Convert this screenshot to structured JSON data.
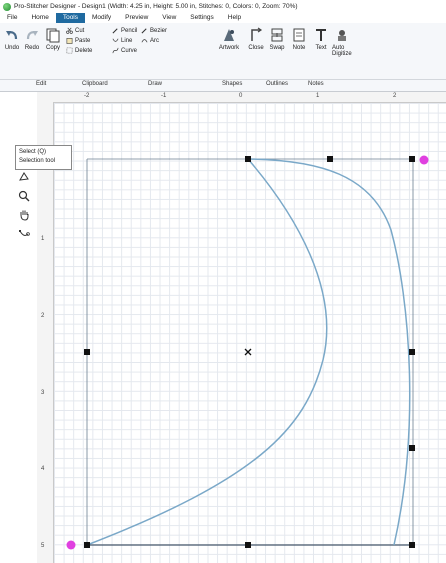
{
  "window": {
    "title": "Pro-Stitcher Designer - Design1 (Width: 4.25 in, Height: 5.00 in, Stitches: 0, Colors: 0, Zoom: 70%)"
  },
  "menu": {
    "items": [
      {
        "label": "File"
      },
      {
        "label": "Home"
      },
      {
        "label": "Tools",
        "active": true
      },
      {
        "label": "Modify"
      },
      {
        "label": "Preview"
      },
      {
        "label": "View"
      },
      {
        "label": "Settings"
      },
      {
        "label": "Help"
      }
    ]
  },
  "ribbon": {
    "undo": "Undo",
    "redo": "Redo",
    "copy": "Copy",
    "cut": "Cut",
    "paste": "Paste",
    "delete": "Delete",
    "pencil": "Pencil",
    "bezier": "Bezier",
    "line": "Line",
    "arc": "Arc",
    "curve": "Curve",
    "artwork": "Artwork",
    "close": "Close",
    "swap": "Swap",
    "note": "Note",
    "text": "Text",
    "auto_line1": "Auto",
    "auto_line2": "Digitize",
    "groups": {
      "edit": "Edit",
      "clipboard": "Clipboard",
      "draw": "Draw",
      "shapes": "Shapes",
      "outlines": "Outlines",
      "notes": "Notes"
    }
  },
  "tooltip": {
    "line1": "Select (Q)",
    "line2": "Selection tool"
  },
  "ruler": {
    "top_labels": [
      "-2",
      "-1",
      "0",
      "1",
      "2"
    ],
    "left_labels": [
      "1",
      "2",
      "3",
      "4",
      "5"
    ]
  },
  "tools": [
    "select-arrow-icon",
    "select-lasso-icon",
    "zoom-icon",
    "pan-hand-icon",
    "node-edit-icon"
  ],
  "colors": {
    "accent": "#1f6aa0",
    "curve": "#7aa8c8",
    "handle": "#111111",
    "endpoint": "#e040e0"
  }
}
